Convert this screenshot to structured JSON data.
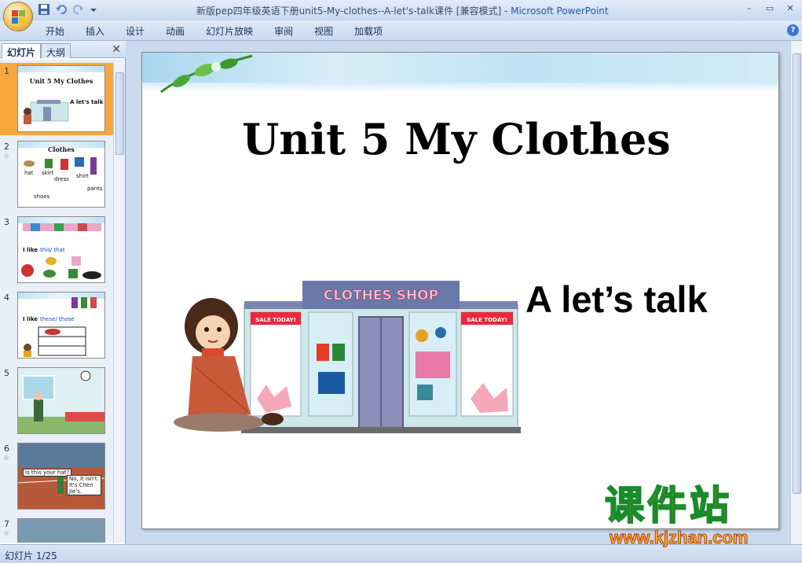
{
  "titlebar": {
    "title": "新版pep四年级英语下册unit5-My-clothes--A-let's-talk课件 [兼容模式]",
    "separator": " - ",
    "app_name": "Microsoft PowerPoint",
    "controls": [
      "–",
      "▭",
      "✕"
    ]
  },
  "ribbon": {
    "tabs": [
      "开始",
      "插入",
      "设计",
      "动画",
      "幻灯片放映",
      "审阅",
      "视图",
      "加载项"
    ],
    "help": "?"
  },
  "left_panel": {
    "tab_slides": "幻灯片",
    "tab_outline": "大纲",
    "close": "✕",
    "thumbnails": [
      {
        "num": "1",
        "title": "Unit 5  My Clothes",
        "sub": "A let's talk"
      },
      {
        "num": "2",
        "title": "Clothes",
        "labels": [
          "hat",
          "skirt",
          "shirt",
          "dress",
          "pants",
          "shoes"
        ]
      },
      {
        "num": "3",
        "text": "I like",
        "text2": "this/  that"
      },
      {
        "num": "4",
        "text": "I like",
        "text2": "these/  those"
      },
      {
        "num": "5"
      },
      {
        "num": "6",
        "bubble1": "Is this your hat?",
        "bubble2": "No, it isn't. It's Chen Jie's."
      },
      {
        "num": "7"
      }
    ]
  },
  "slide": {
    "title": "Unit 5  My Clothes",
    "subtitle": "A let’s talk",
    "shop_sign": "CLOTHES SHOP",
    "sale_tag": "SALE TODAY!"
  },
  "statusbar": {
    "text": "幻灯片 1/25"
  },
  "watermark": {
    "cn": "课件站",
    "url": "www.kjzhan.com"
  },
  "colors": {
    "ribbon": "#c9d9ee",
    "selected_thumb": "#f7a83c",
    "watermark": "#f5c400"
  }
}
